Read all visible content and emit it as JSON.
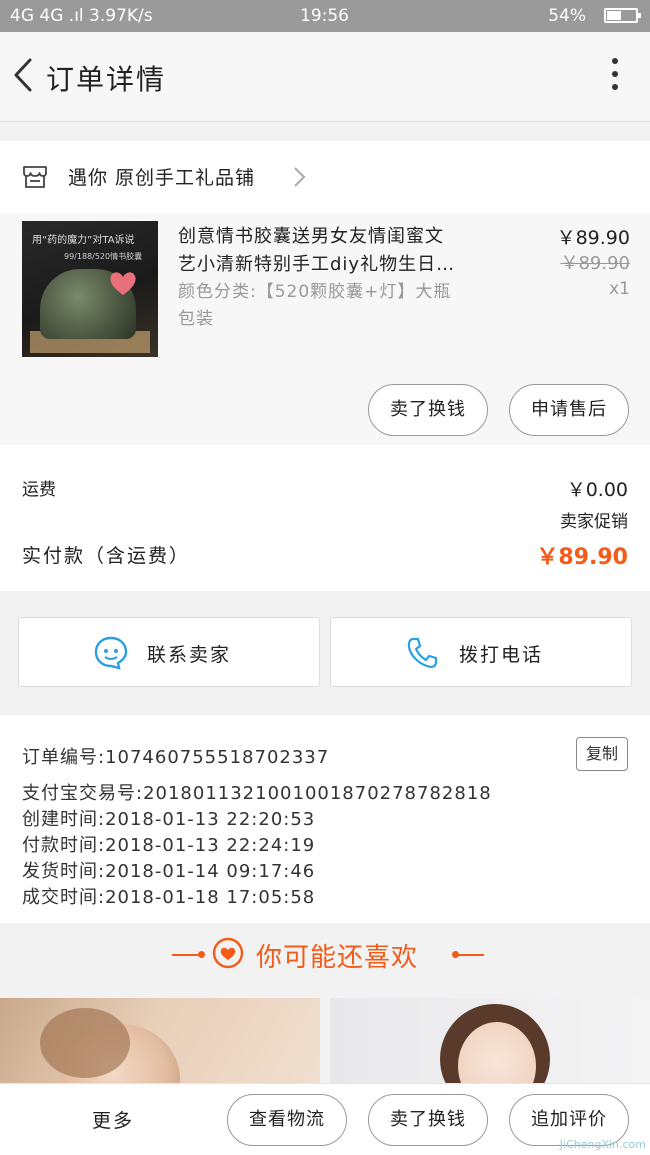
{
  "status_bar": {
    "network": "4G 4G .ıl",
    "speed": "3.97K/s",
    "time": "19:56",
    "battery": "54%"
  },
  "header": {
    "title": "订单详情"
  },
  "shop": {
    "name": "遇你 原创手工礼品铺"
  },
  "product": {
    "image_text_1": "用“药的魔力”对TA诉说",
    "image_text_2": "99/188/520情书胶囊",
    "title_line1": "创意情书胶囊送男女友情闺蜜文",
    "title_line2": "艺小清新特别手工diy礼物生日…",
    "spec_line1": "颜色分类:【520颗胶囊+灯】大瓶",
    "spec_line2": "包装",
    "price": "￥89.90",
    "original_price": "￥89.90",
    "quantity": "x1",
    "btn_sell": "卖了换钱",
    "btn_after_sale": "申请售后"
  },
  "fees": {
    "shipping_label": "运费",
    "shipping_value": "￥0.00",
    "promo": "卖家促销",
    "paid_label": "实付款（含运费）",
    "paid_value": "￥89.90"
  },
  "contact": {
    "seller": "联系卖家",
    "call": "拨打电话"
  },
  "order_info": {
    "order_no": "订单编号:107460755518702337",
    "copy": "复制",
    "alipay_no": "支付宝交易号:2018011321001001870278782818",
    "created": "创建时间:2018-01-13 22:20:53",
    "paid": "付款时间:2018-01-13 22:24:19",
    "shipped": "发货时间:2018-01-14 09:17:46",
    "completed": "成交时间:2018-01-18 17:05:58"
  },
  "recommend": {
    "title": "你可能还喜欢"
  },
  "bottom_bar": {
    "more": "更多",
    "logistics": "查看物流",
    "sell": "卖了换钱",
    "review": "追加评价"
  },
  "watermark": "JiChengXin.com",
  "colors": {
    "accent": "#f25c18",
    "status_bar": "#9a9a9a",
    "contact_icon": "#2aa0e0"
  }
}
